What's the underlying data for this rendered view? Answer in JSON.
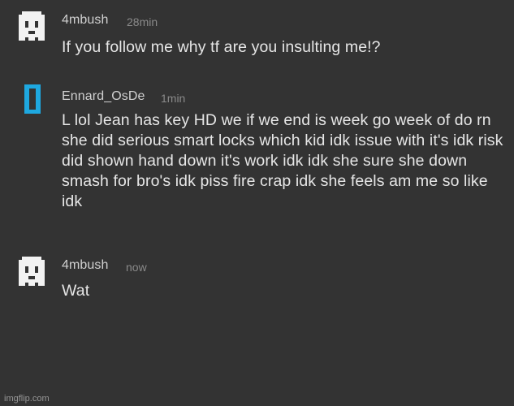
{
  "comments": [
    {
      "username": "4mbush",
      "time": "28min",
      "text": "If you follow me why tf are you insulting me!?",
      "avatar_icon": "ghost-pixel-avatar-icon"
    },
    {
      "username": "Ennard_OsDe",
      "time": "1min",
      "text": "L lol Jean has key HD we if we end is week go week of do rn she did serious smart locks which kid idk issue with it's idk risk did shown hand down it's work idk idk she sure she down smash for bro's idk piss fire crap idk she feels am me so like idk",
      "avatar_icon": "blue-bar-avatar-icon"
    },
    {
      "username": "4mbush",
      "time": "now",
      "text": "Wat",
      "avatar_icon": "ghost-pixel-avatar-icon"
    }
  ],
  "watermark": "imgflip.com",
  "colors": {
    "background": "#333333",
    "username": "#d0d0d0",
    "time": "#8a8a8a",
    "message": "#e6e6e6",
    "blue_avatar": "#1ea8e0"
  }
}
